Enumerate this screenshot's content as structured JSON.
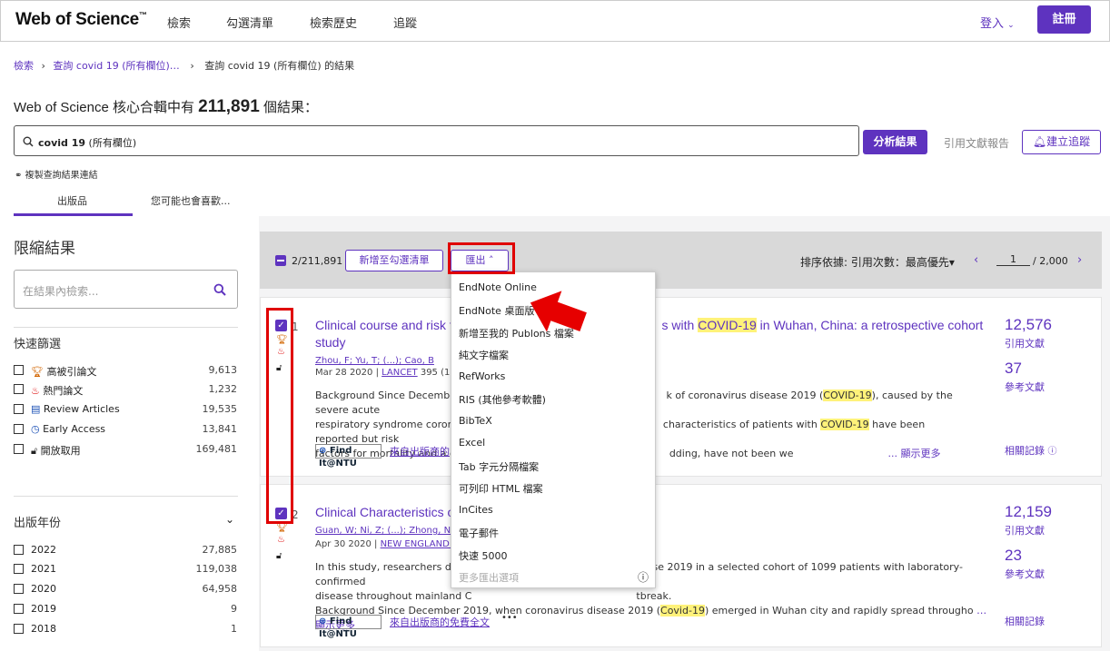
{
  "header": {
    "logo": "Web of Science",
    "logo_tm": "™",
    "nav": [
      "檢索",
      "勾選清單",
      "檢索歷史",
      "追蹤"
    ],
    "login": "登入",
    "signup": "註冊"
  },
  "breadcrumb": {
    "first": "檢索",
    "second": "查詢 covid 19 (所有欄位)…",
    "current": "查詢 covid 19 (所有欄位) 的結果"
  },
  "results_heading": {
    "prefix": "Web of Science 核心合輯中有",
    "count": "211,891",
    "suffix": "個結果："
  },
  "search": {
    "term": "covid 19",
    "field": "(所有欄位)"
  },
  "actions": {
    "analyze": "分析結果",
    "citation_report": "引用文獻報告",
    "create_alert": "建立追蹤"
  },
  "copy_link": "複製查詢結果連結",
  "tabs": [
    "出版品",
    "您可能也會喜歡..."
  ],
  "sidebar": {
    "title": "限縮結果",
    "search_placeholder": "在結果內檢索...",
    "quick_filter_title": "快速篩選",
    "quick_filters": [
      {
        "label": "高被引論文",
        "count": "9,613",
        "icon": "trophy-icon"
      },
      {
        "label": "熱門論文",
        "count": "1,232",
        "icon": "flame-icon"
      },
      {
        "label": "Review Articles",
        "count": "19,535",
        "icon": "document-icon"
      },
      {
        "label": "Early Access",
        "count": "13,841",
        "icon": "clock-icon"
      },
      {
        "label": "開放取用",
        "count": "169,481",
        "icon": "open-lock-icon"
      }
    ],
    "year_title": "出版年份",
    "years": [
      {
        "label": "2022",
        "count": "27,885"
      },
      {
        "label": "2021",
        "count": "119,038"
      },
      {
        "label": "2020",
        "count": "64,958"
      },
      {
        "label": "2019",
        "count": "9"
      },
      {
        "label": "2018",
        "count": "1"
      }
    ]
  },
  "toolbar": {
    "selected": "2/211,891",
    "add_to_list": "新增至勾選清單",
    "export": "匯出",
    "sort_label": "排序依據: 引用次數：最高優先",
    "page": "1",
    "total_pages": "/ 2,000"
  },
  "export_menu": [
    "EndNote Online",
    "EndNote 桌面版",
    "新增至我的 Publons 檔案",
    "純文字檔案",
    "RefWorks",
    "RIS (其他參考軟體)",
    "BibTeX",
    "Excel",
    "Tab 字元分隔檔案",
    "可列印 HTML 檔案",
    "InCites",
    "電子郵件",
    "快速 5000",
    "更多匯出選項"
  ],
  "records": [
    {
      "num": "1",
      "title_a": "Clinical course and risk fa",
      "title_b": "s with ",
      "title_hl": "COVID-19",
      "title_c": " in Wuhan, China: a retrospective cohort",
      "title_d": "study",
      "authors": "Zhou, F; Yu, T; (...); Cao, B",
      "date": "Mar 28 2020 | ",
      "journal": "LANCET",
      "vol": " 395 (10229",
      "abs1a": "Background Since December, 2",
      "abs1b": "k of coronavirus disease 2019 (",
      "abs1hl": "COVID-19",
      "abs1c": "), caused by the severe acute",
      "abs2a": "respiratory syndrome coronavi",
      "abs2b": "characteristics of patients with ",
      "abs2hl": "COVID-19",
      "abs2c": " have been reported but risk",
      "abs3a": "factors for mortality and a detai",
      "abs3b": "dding, have not been we",
      "more": "... 顯示更多",
      "citations": "12,576",
      "citations_label": "引用文獻",
      "refs": "37",
      "refs_label": "參考文獻",
      "related": "相關記錄",
      "findit": "Find It@NTU",
      "free": "來自出版商的"
    },
    {
      "num": "2",
      "title_a": "Clinical Characteristics o",
      "authors": "Guan, W; Ni, Z; (...); Zhong, N",
      "date": "Apr 30 2020 | ",
      "journal": "NEW ENGLAND JO",
      "abs1a": "In this study, researchers descri",
      "abs1b": "ease 2019 in a selected cohort of 1099 patients with laboratory-confirmed",
      "abs2a": "disease throughout mainland C",
      "abs2b": "tbreak.",
      "abs3a": "Background Since December 2019, when coronavirus disease 2019 (",
      "abs3hl": "Covid-19",
      "abs3b": ") emerged in Wuhan city and rapidly spread througho",
      "more": "… 顯示更多",
      "citations": "12,159",
      "citations_label": "引用文獻",
      "refs": "23",
      "refs_label": "參考文獻",
      "related": "相關記錄",
      "findit": "Find It@NTU",
      "free": "來自出版商的免費全文",
      "dots": "•••"
    }
  ],
  "colors": {
    "brand": "#5e33bf",
    "highlight": "#fff27a",
    "annotation": "#e00000"
  }
}
